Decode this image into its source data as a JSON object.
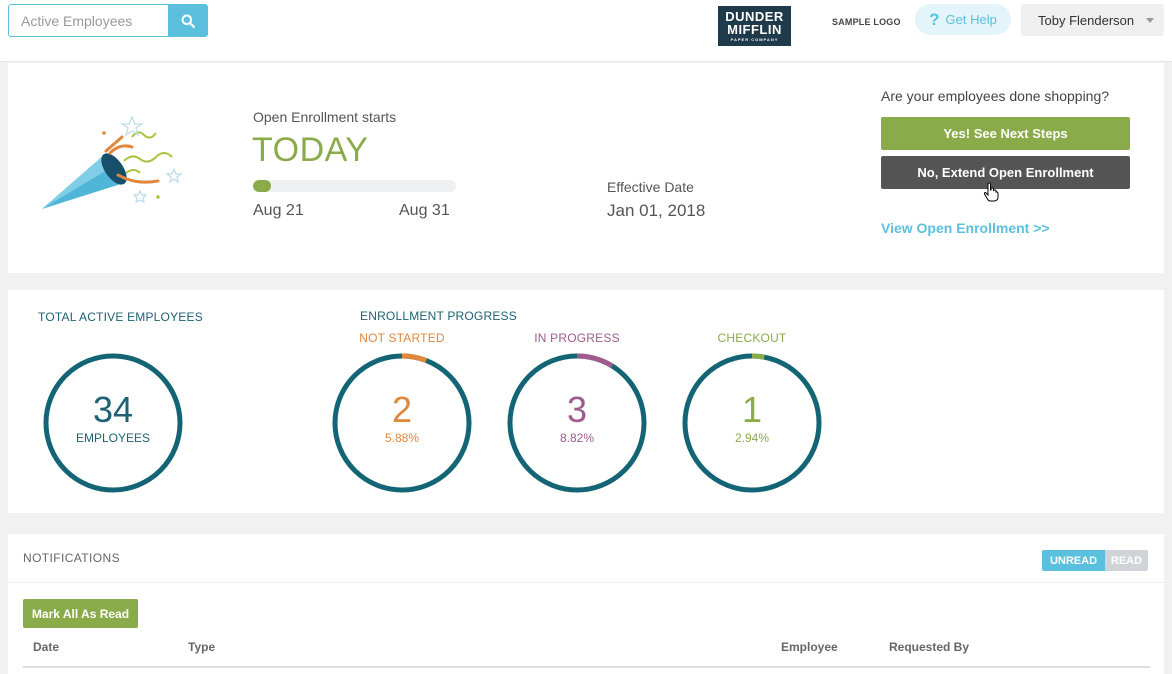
{
  "header": {
    "search": {
      "placeholder": "Active Employees",
      "value": ""
    },
    "logo": {
      "line1": "DUNDER",
      "line2": "MIFFLIN",
      "line3": "PAPER COMPANY"
    },
    "sample_logo": "SAMPLE LOGO",
    "help": {
      "icon": "?",
      "label": "Get Help"
    },
    "user": {
      "name": "Toby Flenderson"
    }
  },
  "enrollment": {
    "label": "Open Enrollment starts",
    "status": "TODAY",
    "progress_percent": 9,
    "start_date": "Aug 21",
    "end_date": "Aug 31",
    "effective_label": "Effective Date",
    "effective_date": "Jan 01, 2018",
    "question": "Are your employees done shopping?",
    "yes_button": "Yes! See Next Steps",
    "no_button": "No, Extend Open Enrollment",
    "view_link": "View Open Enrollment >>"
  },
  "stats": {
    "total_title": "TOTAL ACTIVE EMPLOYEES",
    "total_value": "34",
    "total_unit": "EMPLOYEES",
    "progress_title": "ENROLLMENT PROGRESS",
    "items": [
      {
        "label": "NOT STARTED",
        "value": "2",
        "percent": "5.88%",
        "fraction": 0.0588,
        "color": "#e0873e"
      },
      {
        "label": "IN PROGRESS",
        "value": "3",
        "percent": "8.82%",
        "fraction": 0.0882,
        "color": "#9e5b8c"
      },
      {
        "label": "CHECKOUT",
        "value": "1",
        "percent": "2.94%",
        "fraction": 0.0294,
        "color": "#8aab4a"
      }
    ],
    "ring_color": "#136475"
  },
  "notifications": {
    "title": "NOTIFICATIONS",
    "toggle_unread": "UNREAD",
    "toggle_read": "READ",
    "mark_all": "Mark All As Read",
    "columns": [
      "Date",
      "Type",
      "Employee",
      "Requested By"
    ]
  }
}
